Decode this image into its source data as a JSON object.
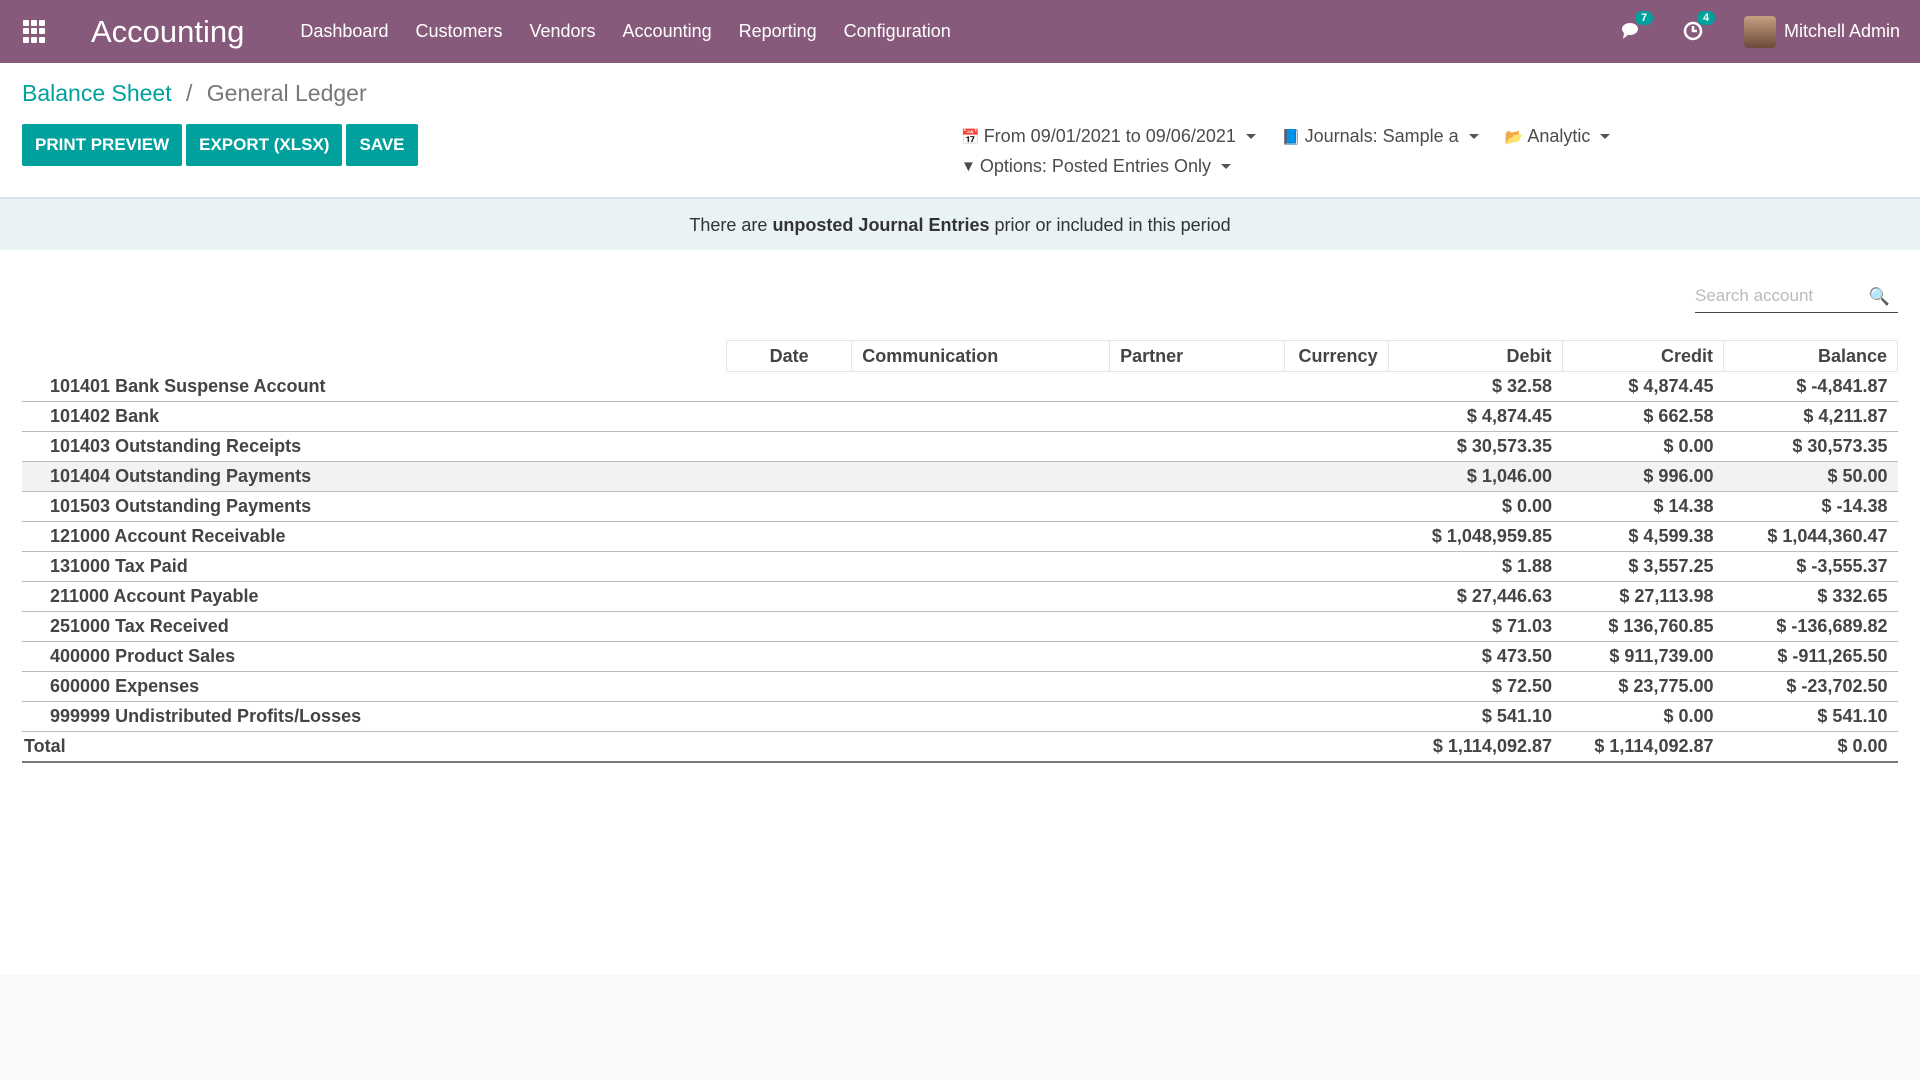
{
  "topbar": {
    "brand": "Accounting",
    "menu": [
      "Dashboard",
      "Customers",
      "Vendors",
      "Accounting",
      "Reporting",
      "Configuration"
    ],
    "messages_count": "7",
    "activities_count": "4",
    "user_name": "Mitchell Admin"
  },
  "breadcrumb": {
    "parent": "Balance Sheet",
    "separator": "/",
    "current": "General Ledger"
  },
  "buttons": {
    "print_preview": "PRINT PREVIEW",
    "export": "EXPORT (XLSX)",
    "save": "SAVE"
  },
  "filters": {
    "date": "From 09/01/2021 to 09/06/2021",
    "journals": "Journals: Sample a",
    "analytic": "Analytic",
    "options": "Options: Posted Entries Only"
  },
  "alert": {
    "prefix": "There are",
    "bold": "unposted Journal Entries",
    "suffix": "prior or included in this period"
  },
  "search": {
    "placeholder": "Search account"
  },
  "table": {
    "headers": {
      "date": "Date",
      "communication": "Communication",
      "partner": "Partner",
      "currency": "Currency",
      "debit": "Debit",
      "credit": "Credit",
      "balance": "Balance"
    },
    "rows": [
      {
        "name": "101401 Bank Suspense Account",
        "debit": "$ 32.58",
        "credit": "$ 4,874.45",
        "balance": "$ -4,841.87"
      },
      {
        "name": "101402 Bank",
        "debit": "$ 4,874.45",
        "credit": "$ 662.58",
        "balance": "$ 4,211.87"
      },
      {
        "name": "101403 Outstanding Receipts",
        "debit": "$ 30,573.35",
        "credit": "$ 0.00",
        "balance": "$ 30,573.35"
      },
      {
        "name": "101404 Outstanding Payments",
        "debit": "$ 1,046.00",
        "credit": "$ 996.00",
        "balance": "$ 50.00"
      },
      {
        "name": "101503 Outstanding Payments",
        "debit": "$ 0.00",
        "credit": "$ 14.38",
        "balance": "$ -14.38"
      },
      {
        "name": "121000 Account Receivable",
        "debit": "$ 1,048,959.85",
        "credit": "$ 4,599.38",
        "balance": "$ 1,044,360.47"
      },
      {
        "name": "131000 Tax Paid",
        "debit": "$ 1.88",
        "credit": "$ 3,557.25",
        "balance": "$ -3,555.37"
      },
      {
        "name": "211000 Account Payable",
        "debit": "$ 27,446.63",
        "credit": "$ 27,113.98",
        "balance": "$ 332.65"
      },
      {
        "name": "251000 Tax Received",
        "debit": "$ 71.03",
        "credit": "$ 136,760.85",
        "balance": "$ -136,689.82"
      },
      {
        "name": "400000 Product Sales",
        "debit": "$ 473.50",
        "credit": "$ 911,739.00",
        "balance": "$ -911,265.50"
      },
      {
        "name": "600000 Expenses",
        "debit": "$ 72.50",
        "credit": "$ 23,775.00",
        "balance": "$ -23,702.50"
      },
      {
        "name": "999999 Undistributed Profits/Losses",
        "debit": "$ 541.10",
        "credit": "$ 0.00",
        "balance": "$ 541.10"
      }
    ],
    "total": {
      "name": "Total",
      "debit": "$ 1,114,092.87",
      "credit": "$ 1,114,092.87",
      "balance": "$ 0.00"
    }
  },
  "colors": {
    "brand": "#875a7b",
    "accent": "#00a09d"
  }
}
